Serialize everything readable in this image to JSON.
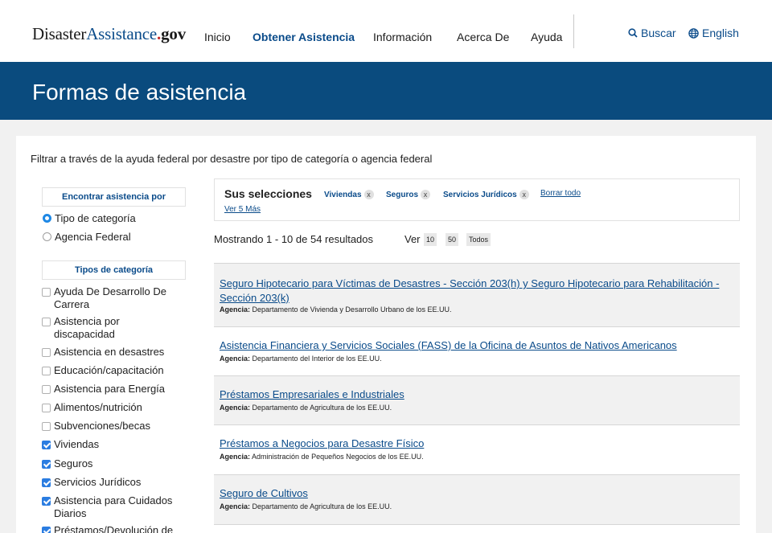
{
  "header": {
    "logo": {
      "part1": "Disaster",
      "part2": "Assistance",
      "dot": ".",
      "part3": "gov"
    },
    "nav": [
      "Inicio",
      "Obtener Asistencia",
      "Información",
      "Acerca De",
      "Ayuda"
    ],
    "search_label": "Buscar",
    "language_label": "English"
  },
  "banner": {
    "title": "Formas de asistencia"
  },
  "intro": "Filtrar a través de la ayuda federal por desastre por tipo de categoría o agencia federal",
  "sidebar": {
    "find_by_heading": "Encontrar asistencia por",
    "options": [
      {
        "label": "Tipo de categoría",
        "selected": true
      },
      {
        "label": "Agencia Federal",
        "selected": false
      }
    ],
    "categories_heading": "Tipos de categoría",
    "categories": [
      {
        "label": "Ayuda De Desarrollo De Carrera",
        "checked": false
      },
      {
        "label": "Asistencia por discapacidad",
        "checked": false
      },
      {
        "label": "Asistencia en desastres",
        "checked": false
      },
      {
        "label": "Educación/capacitación",
        "checked": false
      },
      {
        "label": "Asistencia para Energía",
        "checked": false
      },
      {
        "label": "Alimentos/nutrición",
        "checked": false
      },
      {
        "label": "Subvenciones/becas",
        "checked": false
      },
      {
        "label": "Viviendas",
        "checked": true
      },
      {
        "label": "Seguros",
        "checked": true
      },
      {
        "label": "Servicios Jurídicos",
        "checked": true
      },
      {
        "label": "Asistencia para Cuidados Diarios",
        "checked": true
      },
      {
        "label": "Préstamos/Devolución de",
        "checked": true
      }
    ]
  },
  "selections": {
    "title": "Sus selecciones",
    "chips": [
      "Viviendas",
      "Seguros",
      "Servicios Jurídicos"
    ],
    "remove_glyph": "x",
    "clear_all": "Borrar todo",
    "see_more": "Ver 5 Más"
  },
  "results": {
    "count_text": "Mostrando 1 - 10 de 54 resultados",
    "view_label": "Ver",
    "view_options": [
      "10",
      "50",
      "Todos"
    ],
    "agency_label": "Agencia:",
    "items": [
      {
        "title": "Seguro Hipotecario para Víctimas de Desastres - Sección 203(h) y Seguro Hipotecario para Rehabilitación - Sección 203(k)",
        "agency": "Departamento de Vivienda y Desarrollo Urbano de los EE.UU."
      },
      {
        "title": "Asistencia Financiera y Servicios Sociales (FASS) de la Oficina de Asuntos de Nativos Americanos",
        "agency": "Departamento del Interior de los EE.UU."
      },
      {
        "title": "Préstamos Empresariales e Industriales",
        "agency": "Departamento de Agricultura de los EE.UU."
      },
      {
        "title": "Préstamos a Negocios para Desastre Físico",
        "agency": "Administración de Pequeños Negocios de los EE.UU."
      },
      {
        "title": "Seguro de Cultivos",
        "agency": "Departamento de Agricultura de los EE.UU."
      }
    ]
  },
  "colors": {
    "brand_blue": "#0a4b8a",
    "banner_blue": "#0a4b7e",
    "checkbox_blue": "#2b7de1"
  }
}
